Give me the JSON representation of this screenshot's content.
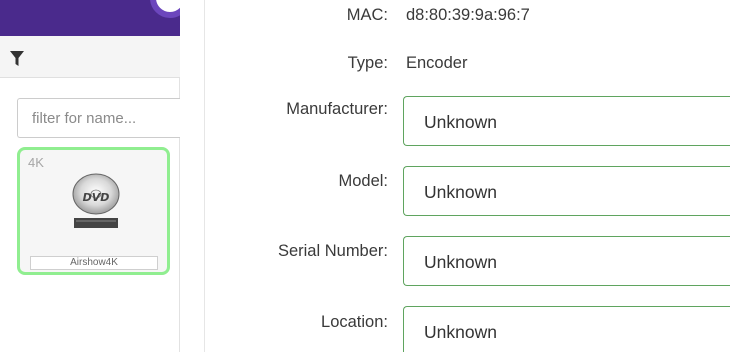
{
  "sidebar": {
    "filter_input": {
      "placeholder": "filter for name..."
    },
    "device": {
      "badge": "4K",
      "icon_name": "dvd-icon",
      "icon_text": "DVD",
      "name": "Airshow4K"
    }
  },
  "details": {
    "mac": {
      "label": "MAC:",
      "value": "d8:80:39:9a:96:7"
    },
    "type": {
      "label": "Type:",
      "value": "Encoder"
    },
    "manufacturer": {
      "label": "Manufacturer:",
      "value": "Unknown"
    },
    "model": {
      "label": "Model:",
      "value": "Unknown"
    },
    "serial_number": {
      "label": "Serial Number:",
      "value": "Unknown"
    },
    "location": {
      "label": "Location:",
      "value": "Unknown"
    }
  },
  "colors": {
    "brand": "#4a2a8c",
    "selected_border": "#90ee90",
    "field_border": "#5fa45f"
  }
}
